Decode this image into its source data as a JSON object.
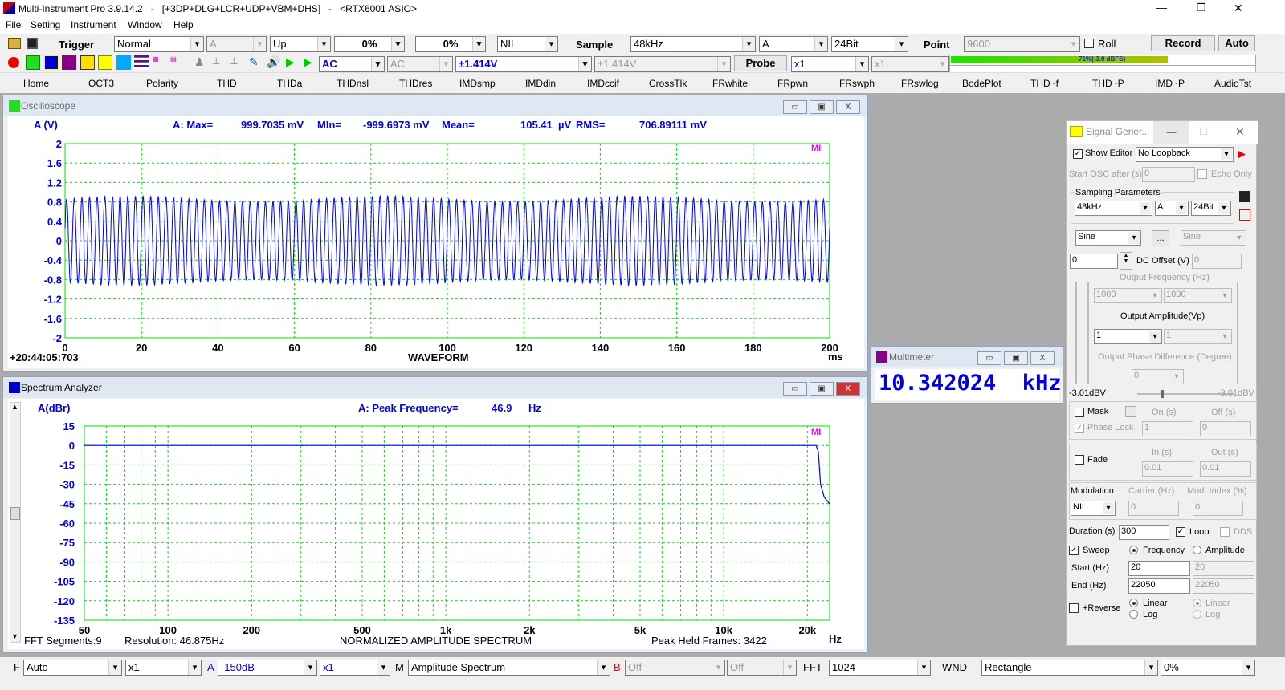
{
  "titlebar": {
    "title": "Multi-Instrument Pro 3.9.14.2   -   [+3DP+DLG+LCR+UDP+VBM+DHS]   -   <RTX6001 ASIO>",
    "minimize": "—",
    "restore": "❐",
    "close": "✕"
  },
  "menu": [
    "File",
    "Setting",
    "Instrument",
    "Window",
    "Help"
  ],
  "toolbar1": {
    "trigger_label": "Trigger",
    "trigger_mode": "Normal",
    "trigger_channel": "A",
    "trigger_edge": "Up",
    "trigger_level": "0%",
    "trigger_delay": "0%",
    "trigger_extra": "NIL",
    "sample_label": "Sample",
    "sample_rate": "48kHz",
    "sample_channel": "A",
    "bit_depth": "24Bit",
    "point_label": "Point",
    "points": "9600",
    "roll_label": "Roll",
    "record_label": "Record",
    "auto_label": "Auto"
  },
  "toolbar2": {
    "coupling_a": "AC",
    "coupling_b": "AC",
    "range_a": "±1.414V",
    "range_b": "±1.414V",
    "probe_label": "Probe",
    "probe_a": "x1",
    "probe_b": "x1",
    "level_meter_text": "71%(-3.0 dBFS)",
    "level_meter_fraction": 0.71,
    "meter_color": "#22e000"
  },
  "tabs": [
    "Home",
    "OCT3",
    "Polarity",
    "THD",
    "THDa",
    "THDnsl",
    "THDres",
    "IMDsmp",
    "IMDdin",
    "IMDccif",
    "CrossTlk",
    "FRwhite",
    "FRpwn",
    "FRswph",
    "FRswlog",
    "BodePlot",
    "THD~f",
    "THD~P",
    "IMD~P",
    "AudioTst"
  ],
  "oscilloscope": {
    "title": "Oscilloscope",
    "y_label": "A (V)",
    "max_label": "A: Max=",
    "max_value": "999.7035 mV",
    "min_label": "MIn=",
    "min_value": "-999.6973 mV",
    "mean_label": "Mean=",
    "mean_value": "105.41  µV",
    "rms_label": "RMS=",
    "rms_value": "706.89111 mV",
    "timestamp": "+20:44:05:703",
    "x_title": "WAVEFORM",
    "x_unit": "ms",
    "logo": "MI",
    "y_ticks": [
      "2",
      "1.6",
      "1.2",
      "0.8",
      "0.4",
      "0",
      "-0.4",
      "-0.8",
      "-1.2",
      "-1.6",
      "-2"
    ],
    "x_ticks": [
      "0",
      "20",
      "40",
      "60",
      "80",
      "100",
      "120",
      "140",
      "160",
      "180",
      "200"
    ],
    "ylim": [
      -2,
      2
    ],
    "xlim": [
      0,
      200
    ],
    "trace_color": "#0000ff",
    "grid_color": "#00e000"
  },
  "spectrum": {
    "title": "Spectrum Analyzer",
    "y_label": "A(dBr)",
    "peak_label": "A: Peak Frequency=",
    "peak_value": "46.9",
    "peak_unit": "Hz",
    "fft_segments": "FFT Segments:9",
    "resolution": "Resolution: 46.875Hz",
    "x_title": "NORMALIZED AMPLITUDE SPECTRUM",
    "peak_held": "Peak Held Frames: 3422",
    "x_unit": "Hz",
    "logo": "MI",
    "y_ticks": [
      "15",
      "0",
      "-15",
      "-30",
      "-45",
      "-60",
      "-75",
      "-90",
      "-105",
      "-120",
      "-135"
    ],
    "x_ticks": [
      "50",
      "100",
      "200",
      "500",
      "1k",
      "2k",
      "5k",
      "10k",
      "20k"
    ],
    "ylim": [
      -135,
      15
    ],
    "x_scale": "log"
  },
  "multimeter": {
    "title": "Multimeter",
    "reading": "10.342024  kHz"
  },
  "siggen": {
    "title": "Signal Gener...",
    "show_editor": "Show Editor",
    "loopback": "No Loopback",
    "start_osc": "Start OSC after (s)",
    "start_osc_value": "0",
    "echo_only": "Echo Only",
    "sampling_params": "Sampling Parameters",
    "rate": "48kHz",
    "channel": "A",
    "bits": "24Bit",
    "wave_a": "Sine",
    "more": "...",
    "wave_b": "Sine",
    "dc_a": "0",
    "dc_label": "DC Offset (V)",
    "dc_b": "0",
    "freq_label": "Output Frequency (Hz)",
    "freq_a": "1000",
    "freq_b": "1000",
    "amp_label": "Output Amplitude(Vp)",
    "amp_a": "1",
    "amp_b": "1",
    "phase_label": "Output Phase Difference (Degree)",
    "phase": "0",
    "level_a": "-3.01dBV",
    "level_b": "-3.01dBV",
    "mask": "Mask",
    "mask_btn": "...",
    "on_label": "On (s)",
    "off_label": "Off (s)",
    "phase_lock": "Phase Lock",
    "on_value": "1",
    "off_value": "0",
    "fade": "Fade",
    "in_label": "In (s)",
    "out_label": "Out (s)",
    "in_value": "0.01",
    "out_value": "0.01",
    "modulation": "Modulation",
    "mod_value": "NIL",
    "carrier_label": "Carrier (Hz)",
    "mod_index_label": "Mod. Index (%)",
    "carrier_value": "0",
    "mod_index_value": "0",
    "duration_label": "Duration (s)",
    "duration": "300",
    "loop": "Loop",
    "dds": "DDS",
    "sweep": "Sweep",
    "frequency": "Frequency",
    "amplitude": "Amplitude",
    "start_label": "Start (Hz)",
    "start_a": "20",
    "start_b": "20",
    "end_label": "End (Hz)",
    "end_a": "22050",
    "end_b": "22050",
    "reverse": "+Reverse",
    "linear": "Linear",
    "log": "Log",
    "linear_b": "Linear",
    "log_b": "Log"
  },
  "bottombar": {
    "f_label": "F",
    "f_value": "Auto",
    "f_mult": "x1",
    "a_label": "A",
    "a_value": "-150dB",
    "a_mult": "x1",
    "m_label": "M",
    "m_value": "Amplitude Spectrum",
    "b_label": "B",
    "b_value": "Off",
    "b_mult": "Off",
    "fft_label": "FFT",
    "fft_value": "1024",
    "wnd_label": "WND",
    "wnd_value": "Rectangle",
    "overlap": "0%"
  }
}
